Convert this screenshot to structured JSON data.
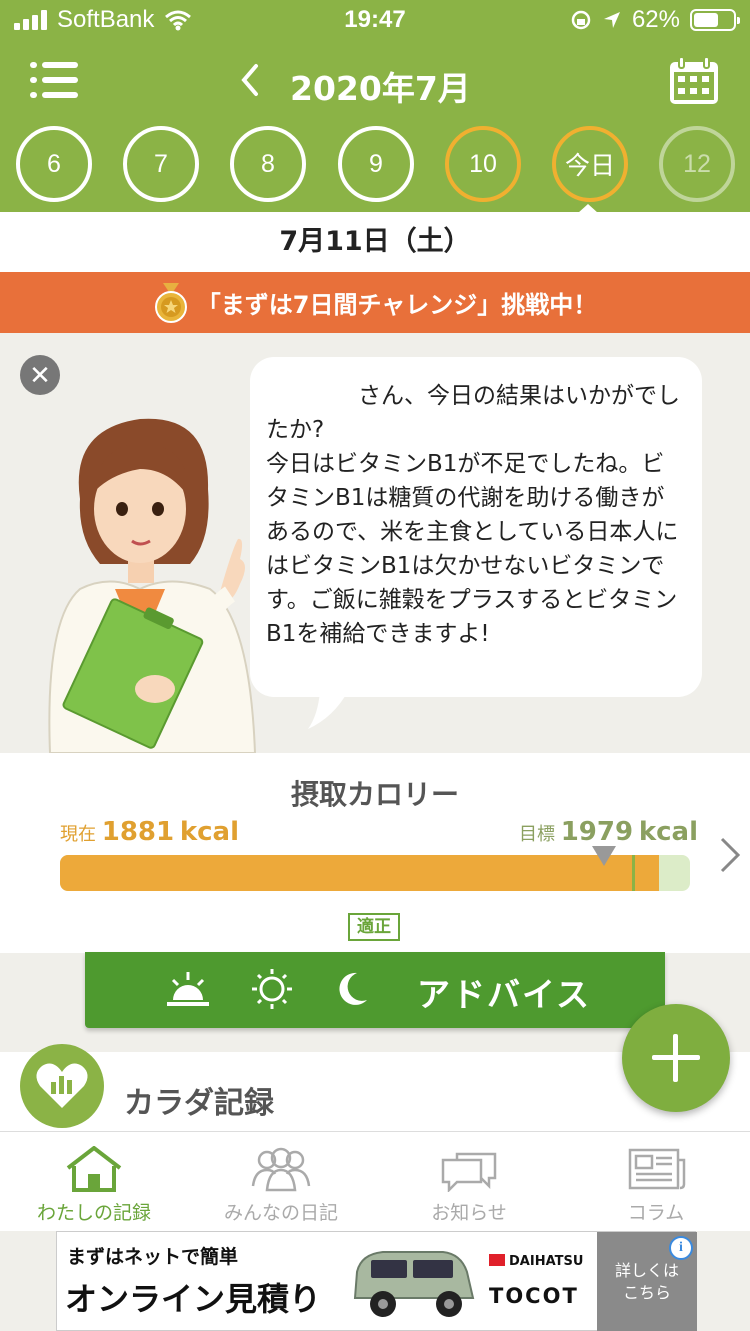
{
  "status_bar": {
    "carrier": "SoftBank",
    "time": "19:47",
    "battery": "62%",
    "battery_level": 0.62
  },
  "header": {
    "month_title": "2020年7月",
    "days": [
      {
        "label": "6",
        "state": "normal"
      },
      {
        "label": "7",
        "state": "normal"
      },
      {
        "label": "8",
        "state": "normal"
      },
      {
        "label": "9",
        "state": "normal"
      },
      {
        "label": "10",
        "state": "warn"
      },
      {
        "label": "今日",
        "state": "today"
      },
      {
        "label": "12",
        "state": "future"
      }
    ]
  },
  "date_label": "7月11日（土）",
  "challenge_banner": "「まずは7日間チャレンジ」挑戦中！",
  "advice": {
    "message": "　　　　さん、今日の結果はいかがでしたか?\n今日はビタミンB1が不足でしたね。ビタミンB1は糖質の代謝を助ける働きがあるので、米を主食としている日本人にはビタミンB1は欠かせないビタミンです。ご飯に雑穀をプラスするとビタミンB1を補給できますよ!"
  },
  "calorie": {
    "title": "摂取カロリー",
    "current_prefix": "現在",
    "current_value": "1881",
    "unit": "kcal",
    "target_prefix": "目標",
    "target_value": "1979",
    "progress": 0.95,
    "status_badge": "適正"
  },
  "advice_button": {
    "label": "アドバイス",
    "icons": [
      "sunrise-icon",
      "sun-icon",
      "moon-icon"
    ]
  },
  "body_record": {
    "label": "カラダ記録"
  },
  "tabbar": {
    "tabs": [
      {
        "label": "わたしの記録",
        "icon": "home-icon",
        "active": true
      },
      {
        "label": "みんなの日記",
        "icon": "people-icon",
        "active": false
      },
      {
        "label": "お知らせ",
        "icon": "chat-icon",
        "active": false
      },
      {
        "label": "コラム",
        "icon": "newspaper-icon",
        "active": false
      }
    ]
  },
  "ad": {
    "line1": "まずはネットで簡単",
    "line2": "オンライン見積り",
    "brand": "DAIHATSU",
    "model": "TOCOT",
    "more": "詳しくは\nこちら",
    "info": "i"
  },
  "colors": {
    "brand_green": "#8bb346",
    "challenge_orange": "#e8703a",
    "calorie_fill": "#eda93a",
    "advice_green": "#4e9a2f"
  }
}
